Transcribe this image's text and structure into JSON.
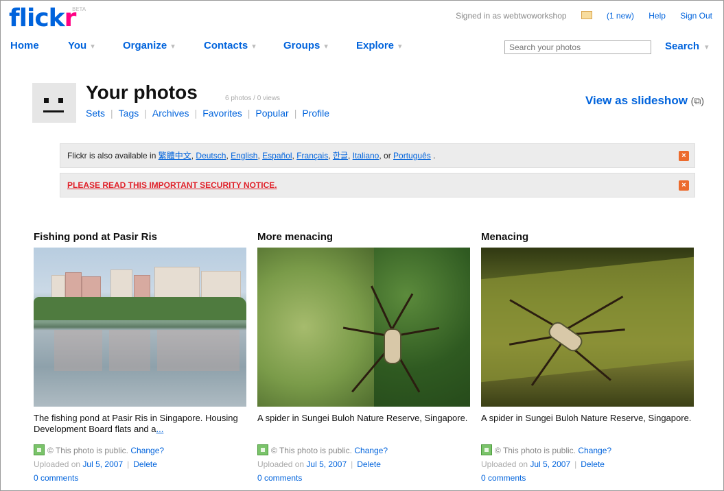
{
  "logo": {
    "text_main": "flick",
    "text_r": "r",
    "badge": "BETA"
  },
  "top": {
    "signed_in": "Signed in as webtwoworkshop",
    "mail": "(1 new)",
    "help": "Help",
    "sign_out": "Sign Out"
  },
  "nav": {
    "home": "Home",
    "you": "You",
    "organize": "Organize",
    "contacts": "Contacts",
    "groups": "Groups",
    "explore": "Explore",
    "arrow": "▾"
  },
  "search": {
    "placeholder": "Search your photos",
    "button": "Search"
  },
  "header": {
    "title": "Your photos",
    "count": "6 photos / 0 views",
    "links": [
      "Sets",
      "Tags",
      "Archives",
      "Favorites",
      "Popular",
      "Profile"
    ],
    "slideshow": "View as slideshow",
    "slideshow_icon": "(⧉)"
  },
  "notices": {
    "lang_prefix": "Flickr is also available in",
    "languages": [
      "繁體中文",
      "Deutsch",
      "English",
      "Español",
      "Français",
      "한글",
      "Italiano",
      "Português"
    ],
    "lang_or": "or",
    "security": "PLEASE READ THIS IMPORTANT SECURITY NOTICE.",
    "close": "×"
  },
  "photos": [
    {
      "title": "Fishing pond at Pasir Ris",
      "desc": "The fishing pond at Pasir Ris in Singapore. Housing Development Board flats and a",
      "more": "...",
      "status_text": "© This photo is public.",
      "change": "Change?",
      "uploaded_prefix": "Uploaded on",
      "date": "Jul 5, 2007",
      "delete": "Delete",
      "comments": "0 comments"
    },
    {
      "title": "More menacing",
      "desc": "A spider in Sungei Buloh Nature Reserve, Singapore.",
      "more": "",
      "status_text": "© This photo is public.",
      "change": "Change?",
      "uploaded_prefix": "Uploaded on",
      "date": "Jul 5, 2007",
      "delete": "Delete",
      "comments": "0 comments"
    },
    {
      "title": "Menacing",
      "desc": "A spider in Sungei Buloh Nature Reserve, Singapore.",
      "more": "",
      "status_text": "© This photo is public.",
      "change": "Change?",
      "uploaded_prefix": "Uploaded on",
      "date": "Jul 5, 2007",
      "delete": "Delete",
      "comments": "0 comments"
    }
  ],
  "colors": {
    "link": "#0063dc",
    "brand_pink": "#ff0084",
    "alert_red": "#e0212a",
    "close_orange": "#ec6b2d"
  }
}
